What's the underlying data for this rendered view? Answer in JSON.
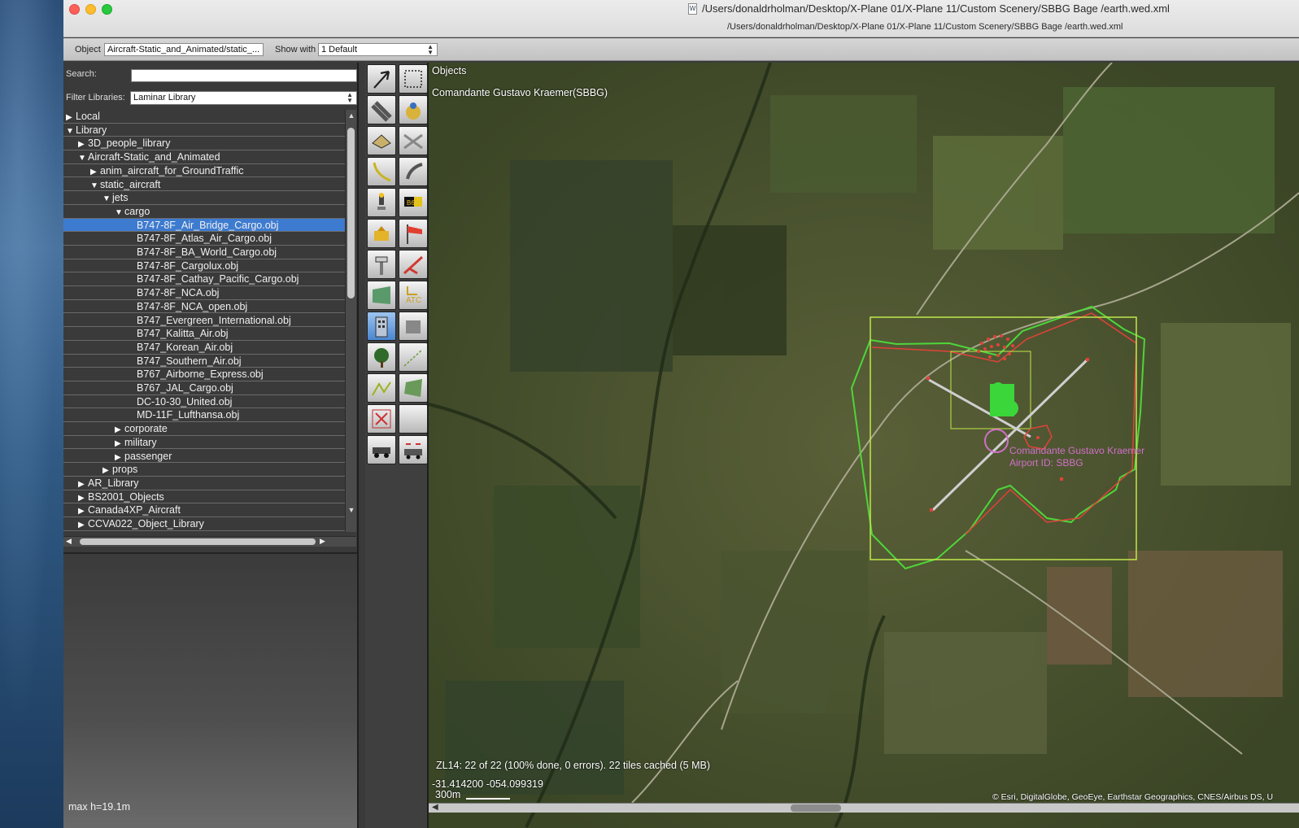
{
  "window": {
    "title": "/Users/donaldrholman/Desktop/X-Plane 01/X-Plane 11/Custom Scenery/SBBG  Bage /earth.wed.xml",
    "path_subtitle": "/Users/donaldrholman/Desktop/X-Plane 01/X-Plane 11/Custom Scenery/SBBG  Bage /earth.wed.xml",
    "doc_icon": "W"
  },
  "toolbar": {
    "object_label": "Object",
    "object_value": "Aircraft-Static_and_Animated/static_...",
    "show_with_label": "Show with",
    "show_with_value": "1 Default"
  },
  "library": {
    "search_label": "Search:",
    "search_value": "",
    "filter_label": "Filter Libraries:",
    "filter_value": "Laminar Library",
    "tree": [
      {
        "label": "Local",
        "level": 0,
        "state": "collapsed"
      },
      {
        "label": "Library",
        "level": 0,
        "state": "expanded"
      },
      {
        "label": "3D_people_library",
        "level": 1,
        "state": "collapsed"
      },
      {
        "label": "Aircraft-Static_and_Animated",
        "level": 1,
        "state": "expanded"
      },
      {
        "label": "anim_aircraft_for_GroundTraffic",
        "level": 2,
        "state": "collapsed"
      },
      {
        "label": "static_aircraft",
        "level": 2,
        "state": "expanded"
      },
      {
        "label": "jets",
        "level": 3,
        "state": "expanded"
      },
      {
        "label": "cargo",
        "level": 4,
        "state": "expanded"
      },
      {
        "label": "B747-8F_Air_Bridge_Cargo.obj",
        "level": 5,
        "state": "leaf",
        "selected": true
      },
      {
        "label": "B747-8F_Atlas_Air_Cargo.obj",
        "level": 5,
        "state": "leaf"
      },
      {
        "label": "B747-8F_BA_World_Cargo.obj",
        "level": 5,
        "state": "leaf"
      },
      {
        "label": "B747-8F_Cargolux.obj",
        "level": 5,
        "state": "leaf"
      },
      {
        "label": "B747-8F_Cathay_Pacific_Cargo.obj",
        "level": 5,
        "state": "leaf"
      },
      {
        "label": "B747-8F_NCA.obj",
        "level": 5,
        "state": "leaf"
      },
      {
        "label": "B747-8F_NCA_open.obj",
        "level": 5,
        "state": "leaf"
      },
      {
        "label": "B747_Evergreen_International.obj",
        "level": 5,
        "state": "leaf"
      },
      {
        "label": "B747_Kalitta_Air.obj",
        "level": 5,
        "state": "leaf"
      },
      {
        "label": "B747_Korean_Air.obj",
        "level": 5,
        "state": "leaf"
      },
      {
        "label": "B747_Southern_Air.obj",
        "level": 5,
        "state": "leaf"
      },
      {
        "label": "B767_Airborne_Express.obj",
        "level": 5,
        "state": "leaf"
      },
      {
        "label": "B767_JAL_Cargo.obj",
        "level": 5,
        "state": "leaf"
      },
      {
        "label": "DC-10-30_United.obj",
        "level": 5,
        "state": "leaf"
      },
      {
        "label": "MD-11F_Lufthansa.obj",
        "level": 5,
        "state": "leaf"
      },
      {
        "label": "corporate",
        "level": 4,
        "state": "collapsed"
      },
      {
        "label": "military",
        "level": 4,
        "state": "collapsed"
      },
      {
        "label": "passenger",
        "level": 4,
        "state": "collapsed"
      },
      {
        "label": "props",
        "level": 3,
        "state": "collapsed"
      },
      {
        "label": "AR_Library",
        "level": 1,
        "state": "collapsed"
      },
      {
        "label": "BS2001_Objects",
        "level": 1,
        "state": "collapsed"
      },
      {
        "label": "Canada4XP_Aircraft",
        "level": 1,
        "state": "collapsed"
      },
      {
        "label": "CCVA022_Object_Library",
        "level": 1,
        "state": "collapsed"
      }
    ],
    "preview_info": "max h=19.1m"
  },
  "tools": [
    {
      "name": "select-tool-icon",
      "active": false
    },
    {
      "name": "marquee-tool-icon",
      "active": false
    },
    {
      "name": "runway-tool-icon",
      "active": false
    },
    {
      "name": "helipad-tool-icon",
      "active": false
    },
    {
      "name": "sealane-tool-icon",
      "active": false
    },
    {
      "name": "taxiway-tool-icon",
      "active": false
    },
    {
      "name": "taxi-route-tool-icon",
      "active": false
    },
    {
      "name": "boundary-tool-icon",
      "active": false
    },
    {
      "name": "light-fixture-tool-icon",
      "active": false
    },
    {
      "name": "sign-tool-icon",
      "active": false
    },
    {
      "name": "ramp-start-tool-icon",
      "active": false
    },
    {
      "name": "windsock-tool-icon",
      "active": false
    },
    {
      "name": "tower-viewpoint-tool-icon",
      "active": false
    },
    {
      "name": "truck-destination-tool-icon",
      "active": false
    },
    {
      "name": "facade-tool-icon",
      "active": false
    },
    {
      "name": "atc-tool-icon",
      "active": false
    },
    {
      "name": "object-tool-icon",
      "active": true
    },
    {
      "name": "autogen-block-tool-icon",
      "active": false
    },
    {
      "name": "forest-tool-icon",
      "active": false
    },
    {
      "name": "string-tool-icon",
      "active": false
    },
    {
      "name": "line-tool-icon",
      "active": false
    },
    {
      "name": "polygon-tool-icon",
      "active": false
    },
    {
      "name": "exclusion-tool-icon",
      "active": false
    },
    {
      "name": "blank-tool-icon",
      "active": false
    },
    {
      "name": "truck-parking-tool-icon",
      "active": false
    },
    {
      "name": "ground-traffic-tool-icon",
      "active": false
    }
  ],
  "map": {
    "title": "Objects",
    "airport_header": "Comandante Gustavo Kraemer(SBBG)",
    "airport_label_name": "Comandante Gustavo Kraemer",
    "airport_label_id": "Airport ID: SBBG",
    "tile_status": "ZL14: 22 of 22 (100% done, 0 errors). 22 tiles cached (5 MB)",
    "coords": "-31.414200 -054.099319",
    "scale_label": "300m",
    "attribution": "© Esri, DigitalGlobe, GeoEye, Earthstar Geographics, CNES/Airbus DS, U"
  },
  "colors": {
    "selection_blue": "#3d7bd0",
    "boundary_green": "#4fd53a",
    "selection_box": "#bfe84a",
    "airport_label": "#d070c8",
    "marker_red": "#e0433a"
  }
}
